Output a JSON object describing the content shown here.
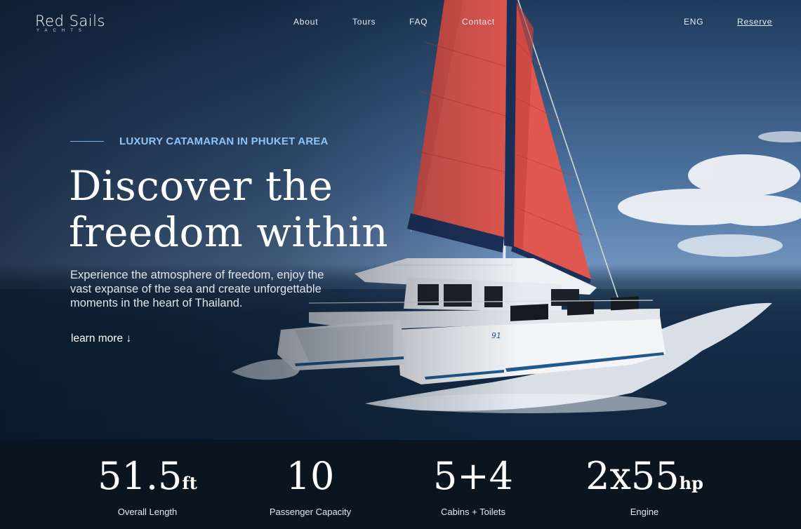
{
  "brand": {
    "name": "Red Sails",
    "tagline": "YACHTS"
  },
  "nav": {
    "items": [
      {
        "label": "About"
      },
      {
        "label": "Tours"
      },
      {
        "label": "FAQ"
      },
      {
        "label": "Contact"
      }
    ],
    "language": "ENG",
    "reserve": "Reserve"
  },
  "hero": {
    "eyebrow": "LUXURY CATAMARAN IN PHUKET AREA",
    "headline": [
      "Discover the",
      "freedom within"
    ],
    "lede": [
      "Experience the atmosphere of freedom, enjoy the",
      "vast expanse of the sea and create unforgettable",
      "moments in the heart of Thailand."
    ],
    "cta": "learn more ↓",
    "hull_text": "91"
  },
  "specs": [
    {
      "value": "51.5",
      "unit": "ft",
      "label": "Overall Length"
    },
    {
      "value": "10",
      "unit": "",
      "label": "Passenger Capacity"
    },
    {
      "value": "5+4",
      "unit": "",
      "label": "Cabins + Toilets"
    },
    {
      "value": "2x55",
      "unit": "hp",
      "label": "Engine"
    }
  ],
  "colors": {
    "sail": "#e0574f",
    "sail_shadow": "#c8453e",
    "mast_stripe": "#1c2f57",
    "accent": "#8ec4f5",
    "specs_bg": "#0a1520"
  }
}
